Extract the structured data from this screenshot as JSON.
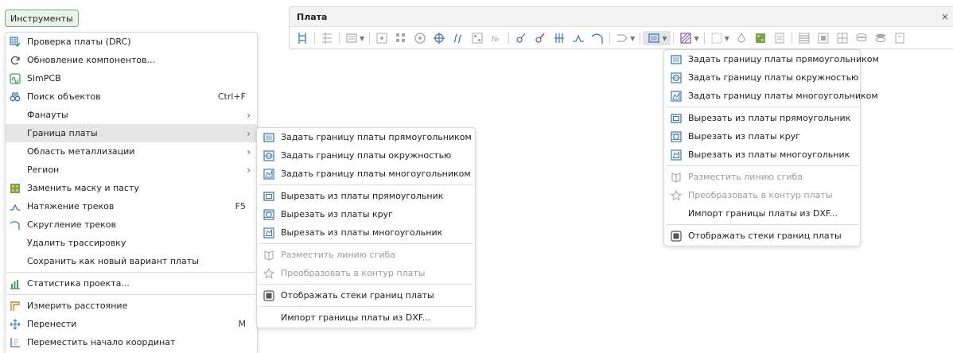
{
  "tools_button": "Инструменты",
  "main_menu": [
    {
      "type": "item",
      "icon": "drc-icon",
      "label": "Проверка платы (DRC)"
    },
    {
      "type": "item",
      "icon": "refresh-icon",
      "label": "Обновление компонентов..."
    },
    {
      "type": "item",
      "icon": "simpcb-icon",
      "label": "SimPCB"
    },
    {
      "type": "item",
      "icon": "binoculars-icon",
      "label": "Поиск объектов",
      "shortcut": "Ctrl+F"
    },
    {
      "type": "item",
      "label": "Фанауты",
      "submenu": true
    },
    {
      "type": "item",
      "label": "Граница платы",
      "submenu": true,
      "highlight": true
    },
    {
      "type": "item",
      "label": "Область металлизации",
      "submenu": true
    },
    {
      "type": "item",
      "label": "Регион",
      "submenu": true
    },
    {
      "type": "item",
      "icon": "mask-icon",
      "label": "Заменить маску и пасту"
    },
    {
      "type": "item",
      "icon": "tension-icon",
      "label": "Натяжение треков",
      "shortcut": "F5"
    },
    {
      "type": "item",
      "icon": "arc-icon",
      "label": "Скругление треков"
    },
    {
      "type": "item",
      "label": "Удалить трассировку"
    },
    {
      "type": "item",
      "label": "Сохранить как новый вариант платы"
    },
    {
      "type": "sep"
    },
    {
      "type": "item",
      "icon": "stats-icon",
      "label": "Статистика проекта..."
    },
    {
      "type": "sep"
    },
    {
      "type": "item",
      "icon": "measure-icon",
      "label": "Измерить расстояние"
    },
    {
      "type": "item",
      "icon": "move-icon",
      "label": "Перенести",
      "shortcut": "M"
    },
    {
      "type": "item",
      "icon": "origin-icon",
      "label": "Переместить начало координат"
    }
  ],
  "sub_menu": [
    {
      "type": "item",
      "icon": "rect-board-icon",
      "label": "Задать границу платы прямоугольником"
    },
    {
      "type": "item",
      "icon": "circle-board-icon",
      "label": "Задать границу платы окружностью"
    },
    {
      "type": "item",
      "icon": "polygon-board-icon",
      "label": "Задать границу платы многоугольником"
    },
    {
      "type": "sep"
    },
    {
      "type": "item",
      "icon": "rect-cut-icon",
      "label": "Вырезать из платы прямоугольник"
    },
    {
      "type": "item",
      "icon": "circle-cut-icon",
      "label": "Вырезать из платы круг"
    },
    {
      "type": "item",
      "icon": "polygon-cut-icon",
      "label": "Вырезать из платы многоугольник"
    },
    {
      "type": "sep"
    },
    {
      "type": "item",
      "icon": "bend-line-icon",
      "label": "Разместить линию сгиба",
      "disabled": true
    },
    {
      "type": "item",
      "icon": "convert-outline-icon",
      "label": "Преобразовать в контур платы",
      "disabled": true
    },
    {
      "type": "sep"
    },
    {
      "type": "item",
      "icon": "stack-checkbox-icon",
      "label": "Отображать стеки границ платы"
    },
    {
      "type": "sep"
    },
    {
      "type": "item",
      "label": "Импорт границы платы из DXF..."
    }
  ],
  "panel": {
    "title": "Плата",
    "close": "×"
  },
  "drop_menu": [
    {
      "type": "item",
      "icon": "rect-board-icon",
      "label": "Задать границу платы прямоугольником"
    },
    {
      "type": "item",
      "icon": "circle-board-icon",
      "label": "Задать границу платы окружностью"
    },
    {
      "type": "item",
      "icon": "polygon-board-icon",
      "label": "Задать границу платы многоугольником"
    },
    {
      "type": "sep"
    },
    {
      "type": "item",
      "icon": "rect-cut-icon",
      "label": "Вырезать из платы прямоугольник"
    },
    {
      "type": "item",
      "icon": "circle-cut-icon",
      "label": "Вырезать из платы круг"
    },
    {
      "type": "item",
      "icon": "polygon-cut-icon",
      "label": "Вырезать из платы многоугольник"
    },
    {
      "type": "sep"
    },
    {
      "type": "item",
      "icon": "bend-line-icon",
      "label": "Разместить линию сгиба",
      "disabled": true
    },
    {
      "type": "item",
      "icon": "convert-outline-icon",
      "label": "Преобразовать в контур платы",
      "disabled": true
    },
    {
      "type": "item",
      "label": "Импорт границы платы из DXF..."
    },
    {
      "type": "sep"
    },
    {
      "type": "item",
      "icon": "stack-checkbox-icon",
      "label": "Отображать стеки границ платы"
    }
  ],
  "colors": {
    "accent_green": "#67ad7e",
    "highlight": "#e6e6e6",
    "icon_blue": "#3a78c2"
  }
}
